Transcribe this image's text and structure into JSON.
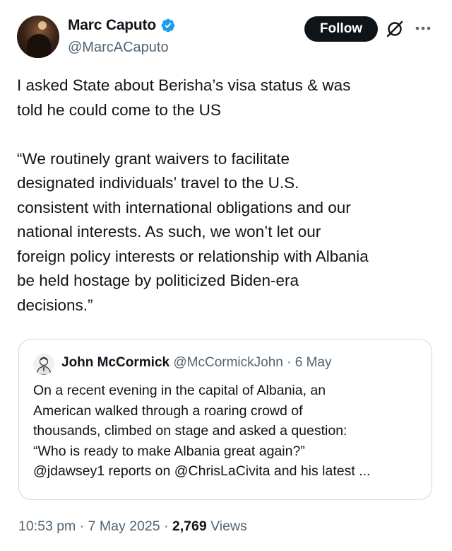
{
  "author": {
    "display_name": "Marc Caputo",
    "handle": "@MarcACaputo",
    "verified": true
  },
  "actions": {
    "follow_label": "Follow",
    "grok_icon": "grok-icon",
    "more_icon": "more-icon"
  },
  "tweet": {
    "text": "I asked State about Berisha’s visa status & was\ntold he could come to the US\n\n“We routinely grant waivers to facilitate\ndesignated individuals’ travel to the U.S.\nconsistent with international obligations and our\nnational interests. As such, we won’t let our\nforeign policy interests or relationship with Albania\nbe held hostage by politicized Biden-era\ndecisions.”"
  },
  "quoted_tweet": {
    "display_name": "John McCormick",
    "handle": "@McCormickJohn",
    "separator": " · ",
    "date": "6 May",
    "text": "On a recent evening in the capital of Albania, an\nAmerican walked through a roaring crowd of\nthousands, climbed on stage and asked a question:\n“Who is ready to make Albania great again?”\n@jdawsey1 reports on @ChrisLaCivita and his latest ..."
  },
  "footer": {
    "time": "10:53 pm",
    "separator": " · ",
    "date": "7 May 2025",
    "views_count": "2,769",
    "views_label": " Views"
  },
  "colors": {
    "verified_blue": "#1d9bf0",
    "follow_bg": "#0f1419",
    "secondary_text": "#536471",
    "border": "#cfd9de"
  }
}
